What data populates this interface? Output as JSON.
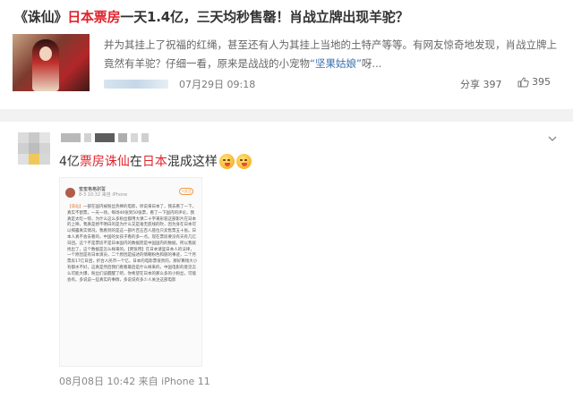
{
  "colors": {
    "red": "#e0242c",
    "link_blue": "#3a6fb0",
    "gray_text": "#888888"
  },
  "article": {
    "title_prefix": "《诛仙》",
    "title_red": "日本票房",
    "title_rest": "一天1.4亿，三天均秒售罄！肖战立牌出现羊驼？",
    "summary_1": "并为其挂上了祝福的红绳，甚至还有人为其挂上当地的土特产等等。有网友惊奇地发现，肖战立牌上竟然有羊驼？仔细一看，原来是战战的小宠物",
    "summary_link": "“坚果姑娘”",
    "summary_end": "呀...",
    "date": "07月29日 09:18",
    "share_label": "分享",
    "share_count": "397",
    "like_icon": "thumb-up-icon",
    "like_count": "395"
  },
  "post": {
    "text_1": "4亿",
    "text_red_1": "票房诛仙",
    "text_2": "在",
    "text_red_2": "日本",
    "text_3": "混成这样",
    "emoji_icon": "yum-face-icon",
    "chevron_icon": "chevron-down-icon",
    "footer": "08月08日 10:42  来自 iPhone 11",
    "screenshot": {
      "name": "蜜蜜格格驸誓",
      "sub": "8-3 10:32  来自 iPhone",
      "follow": "+关注",
      "tag": "【诛仙】",
      "body": "一部在国内被粉丝热捧的电影，听说来日本了，我去看了一下，真实不割票，一天一场，每场40张到50张票，看了一下国内的评论，我真是太吃一惊，为什么这么多粉丝都用大课二十字来形容这部影片在日本的上映，我真是想不明白的是为什么又是毫无底线的吹，因为身在日本可以揭露真实情况，我看到的是这一部片百五百人座位只卖售票五十张。日本人真不会去看的，中国的女孩子看的多一点。现在票房要没有天有几亿日团。这个不是票房不是日本国内的数据而是中国国内的数据，所以我就找出了，这个数据是怎么样来的。【粥饭用】在日本请里日本人的法律，一个原因是有日本演员，二个原因是描述的情朝粉色和丽的事迹，二个月票房17亿日团，折合人民币一个亿，日本的电影票很贵的，那好算钱大小有都水不好，这真是然后我们看看最后是什么样来的，中国电影的意见怎么可能大爆，粉丝们该醒醒了吧，你希望在日本的那么多的小粉丝，可能会有。多说说一些真实的事情，多说说有多少人关注这部电影"
    }
  }
}
